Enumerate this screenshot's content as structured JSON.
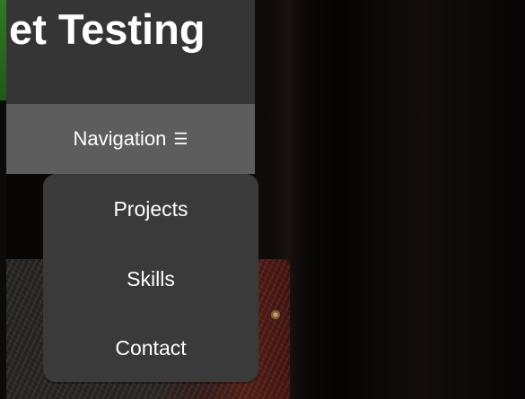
{
  "header": {
    "title": "let Testing"
  },
  "navigation": {
    "label": "Navigation",
    "menu_icon": "☰",
    "items": [
      {
        "label": "Projects"
      },
      {
        "label": "Skills"
      },
      {
        "label": "Contact"
      }
    ]
  },
  "colors": {
    "header_bg": "#353535",
    "nav_bg": "#5d5d5d",
    "menu_bg": "#3a3a3a",
    "green_edge": "#2f7a23",
    "text": "#ffffff"
  },
  "icons": {
    "menu": "hamburger-icon"
  }
}
